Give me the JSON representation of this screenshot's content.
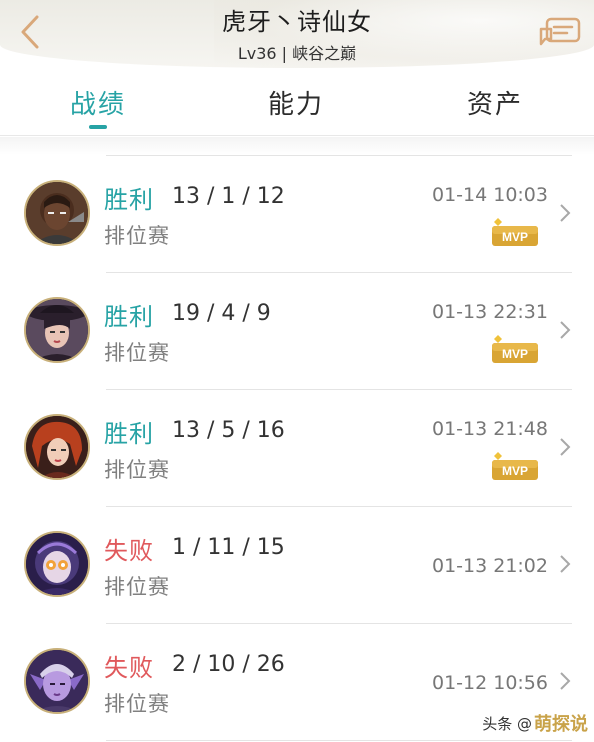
{
  "header": {
    "name": "虎牙丶诗仙女",
    "level": "Lv36",
    "separator": "|",
    "rank": "峡谷之巅"
  },
  "tabs": [
    {
      "label": "战绩",
      "active": true
    },
    {
      "label": "能力",
      "active": false
    },
    {
      "label": "资产",
      "active": false
    }
  ],
  "matches": [
    {
      "result": "胜利",
      "outcome": "win",
      "kda": "13 / 1 / 12",
      "mode": "排位赛",
      "time": "01-14 10:03",
      "mvp": true,
      "hero_avatar": "hero-avatar-dark-warrior"
    },
    {
      "result": "胜利",
      "outcome": "win",
      "kda": "19 / 4 / 9",
      "mode": "排位赛",
      "time": "01-13 22:31",
      "mvp": true,
      "hero_avatar": "hero-avatar-hat-woman"
    },
    {
      "result": "胜利",
      "outcome": "win",
      "kda": "13 / 5 / 16",
      "mode": "排位赛",
      "time": "01-13 21:48",
      "mvp": true,
      "hero_avatar": "hero-avatar-red-hair"
    },
    {
      "result": "失败",
      "outcome": "loss",
      "kda": "1 / 11 / 15",
      "mode": "排位赛",
      "time": "01-13 21:02",
      "mvp": false,
      "hero_avatar": "hero-avatar-mask-purple"
    },
    {
      "result": "失败",
      "outcome": "loss",
      "kda": "2 / 10 / 26",
      "mode": "排位赛",
      "time": "01-12 10:56",
      "mvp": false,
      "hero_avatar": "hero-avatar-purple-elf"
    }
  ],
  "mvp_label": "MVP",
  "watermark": {
    "prefix": "头条 @",
    "brand": "萌探说"
  },
  "colors": {
    "win": "#27a3a5",
    "loss": "#e0595c",
    "accent": "#27a3a5",
    "mvp_gold": "#d9a534"
  }
}
